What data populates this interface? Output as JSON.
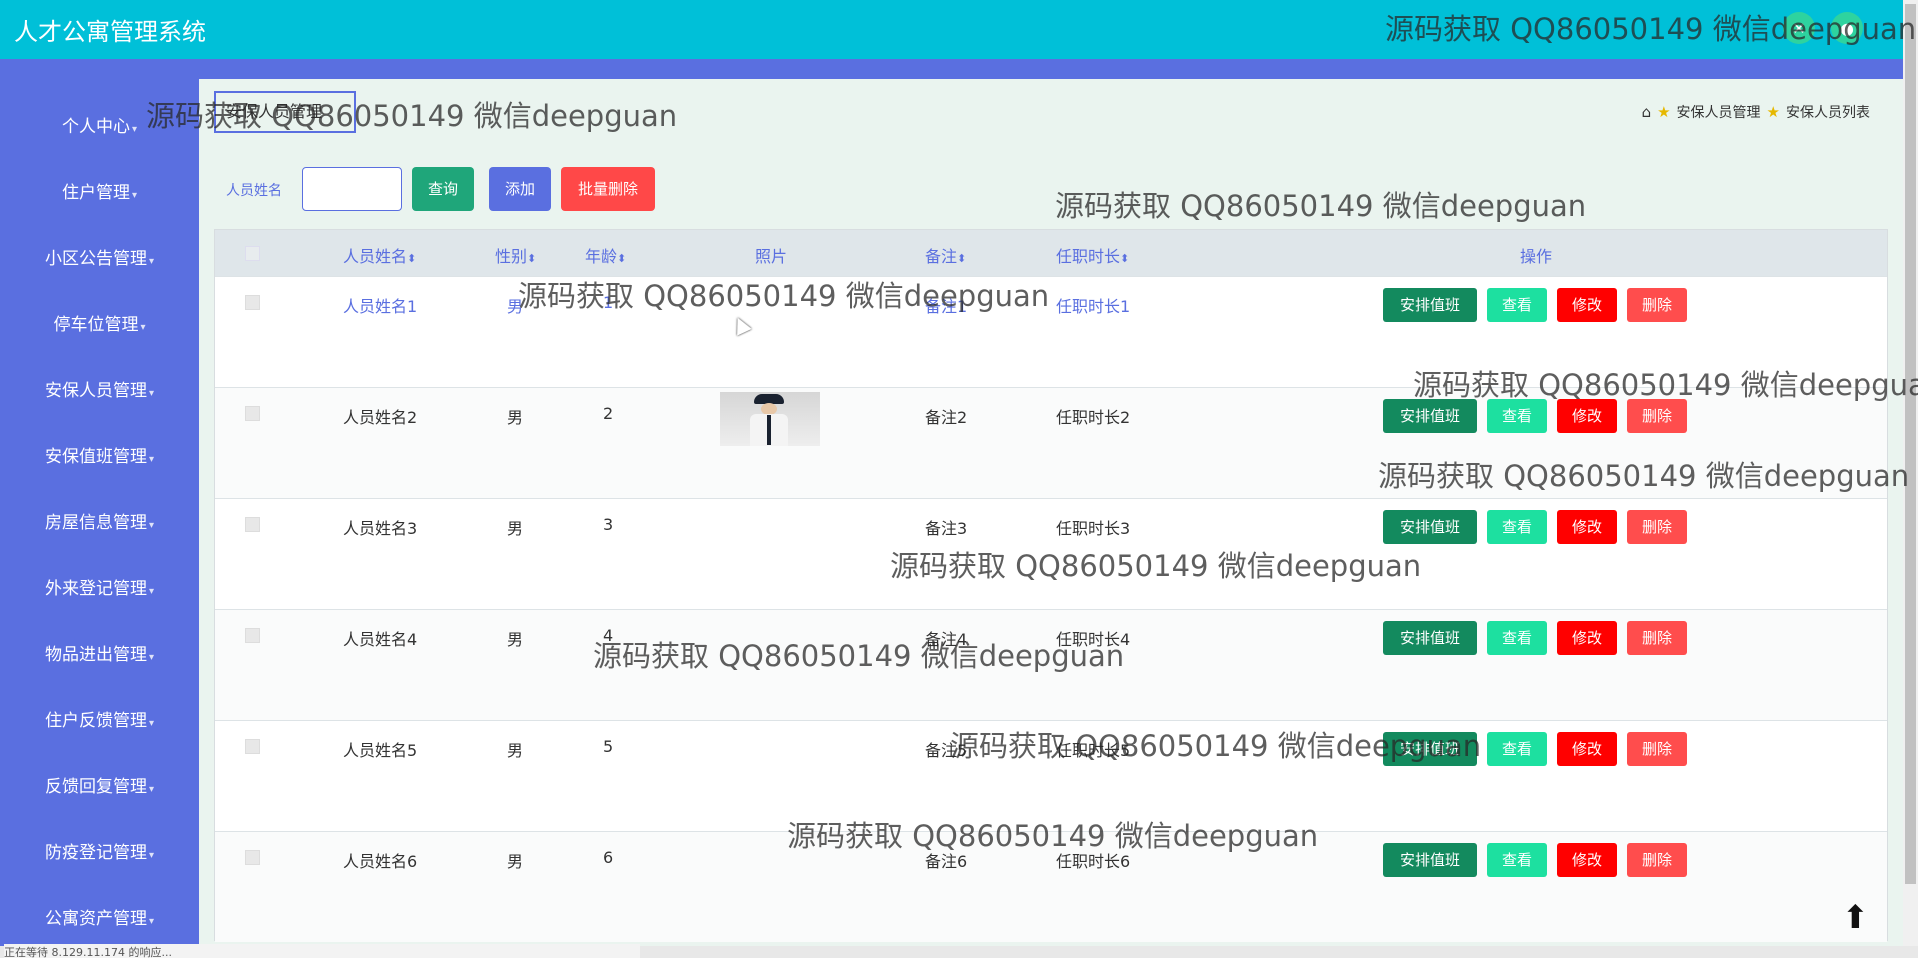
{
  "app": {
    "title": "人才公寓管理系统"
  },
  "top_icons": [
    {
      "icon": "close-icon",
      "glyph": "✕"
    },
    {
      "icon": "user-icon",
      "glyph": "●"
    }
  ],
  "sidebar": {
    "items": [
      {
        "label": "个人中心"
      },
      {
        "label": "住户管理"
      },
      {
        "label": "小区公告管理"
      },
      {
        "label": "停车位管理"
      },
      {
        "label": "安保人员管理"
      },
      {
        "label": "安保值班管理"
      },
      {
        "label": "房屋信息管理"
      },
      {
        "label": "外来登记管理"
      },
      {
        "label": "物品进出管理"
      },
      {
        "label": "住户反馈管理"
      },
      {
        "label": "反馈回复管理"
      },
      {
        "label": "防疫登记管理"
      },
      {
        "label": "公寓资产管理"
      }
    ]
  },
  "page": {
    "title": "安保人员管理"
  },
  "breadcrumb": {
    "home_icon": "home-icon",
    "items": [
      "安保人员管理",
      "安保人员列表"
    ]
  },
  "search": {
    "label": "人员姓名",
    "value": "",
    "query": "查询",
    "add": "添加",
    "batch_delete": "批量删除"
  },
  "table": {
    "headers": [
      "人员姓名",
      "性别",
      "年龄",
      "照片",
      "备注",
      "任职时长",
      "操作"
    ],
    "actions": {
      "duty": "安排值班",
      "view": "查看",
      "edit": "修改",
      "delete": "删除"
    },
    "rows": [
      {
        "name": "人员姓名1",
        "gender": "男",
        "age": "1",
        "has_photo": false,
        "remark": "备注1",
        "tenure": "任职时长1"
      },
      {
        "name": "人员姓名2",
        "gender": "男",
        "age": "2",
        "has_photo": true,
        "remark": "备注2",
        "tenure": "任职时长2"
      },
      {
        "name": "人员姓名3",
        "gender": "男",
        "age": "3",
        "has_photo": false,
        "remark": "备注3",
        "tenure": "任职时长3"
      },
      {
        "name": "人员姓名4",
        "gender": "男",
        "age": "4",
        "has_photo": false,
        "remark": "备注4",
        "tenure": "任职时长4"
      },
      {
        "name": "人员姓名5",
        "gender": "男",
        "age": "5",
        "has_photo": false,
        "remark": "备注5",
        "tenure": "任职时长5"
      },
      {
        "name": "人员姓名6",
        "gender": "男",
        "age": "6",
        "has_photo": false,
        "remark": "备注6",
        "tenure": "任职时长6"
      }
    ]
  },
  "status": {
    "text": "正在等待 8.129.11.174 的响应..."
  },
  "watermark": {
    "text": "源码获取 QQ86050149 微信deepguan"
  },
  "colors": {
    "header": "#00c0d8",
    "sidebar": "#5a6fe0",
    "accent_green": "#1fa67a",
    "danger": "#ff0000"
  }
}
